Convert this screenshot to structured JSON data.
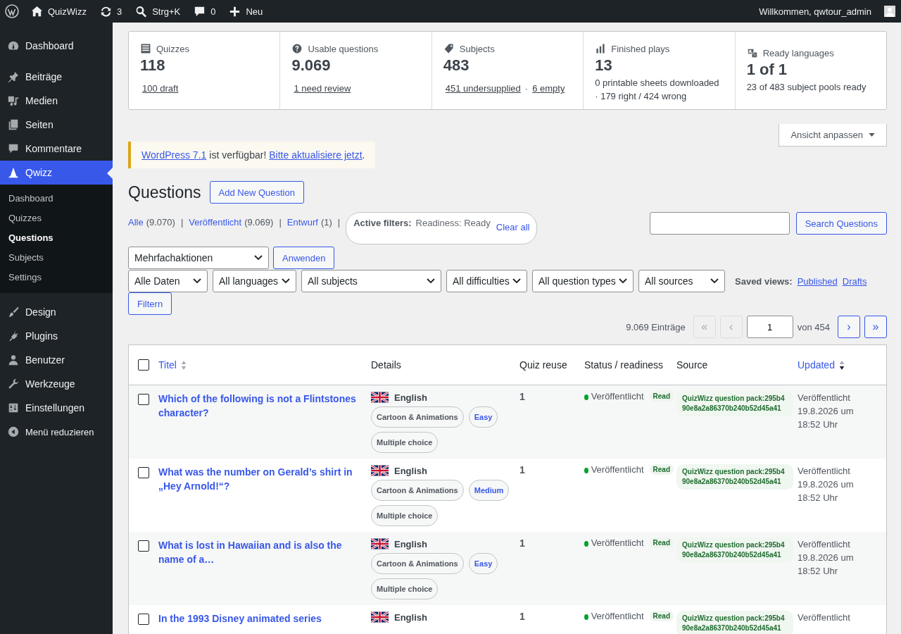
{
  "admin_bar": {
    "items": [
      {
        "label": "QuizWizz"
      },
      {
        "label": "3"
      },
      {
        "label": "Strg+K"
      },
      {
        "label": "0"
      },
      {
        "label": "Neu"
      }
    ],
    "greeting": "Willkommen, qwtour_admin"
  },
  "sidebar": {
    "items": [
      {
        "label": "Dashboard",
        "selected": false
      },
      {
        "label": "Beiträge",
        "selected": false
      },
      {
        "label": "Medien",
        "selected": false
      },
      {
        "label": "Seiten",
        "selected": false
      },
      {
        "label": "Kommentare",
        "selected": false
      },
      {
        "label": "Qwizz",
        "selected": true,
        "children": [
          {
            "label": "Dashboard",
            "selected": false
          },
          {
            "label": "Quizzes",
            "selected": false
          },
          {
            "label": "Questions",
            "selected": true
          },
          {
            "label": "Subjects",
            "selected": false
          },
          {
            "label": "Settings",
            "selected": false
          }
        ]
      },
      {
        "label": "Design",
        "selected": false
      },
      {
        "label": "Plugins",
        "selected": false
      },
      {
        "label": "Benutzer",
        "selected": false
      },
      {
        "label": "Werkzeuge",
        "selected": false
      },
      {
        "label": "Einstellungen",
        "selected": false
      }
    ],
    "collapse": "Menü reduzieren"
  },
  "stats": [
    {
      "label": "Quizzes",
      "value": "118",
      "links": [
        "100 draft"
      ]
    },
    {
      "label": "Usable questions",
      "value": "9.069",
      "links": [
        "1 need review"
      ]
    },
    {
      "label": "Subjects",
      "value": "483",
      "links": [
        "451 undersupplied",
        "6 empty"
      ],
      "separator": "·"
    },
    {
      "label": "Finished plays",
      "value": "13",
      "lines": [
        "0 printable sheets downloaded",
        "· 179 right / 424 wrong"
      ]
    },
    {
      "label": "Ready languages",
      "value": "1 of 1",
      "lines": [
        "23 of 483 subject pools ready"
      ]
    }
  ],
  "screen_options": "Ansicht anpassen",
  "notice": {
    "link": "WordPress 7.1",
    "text": "ist verfügbar!",
    "action": "Bitte aktualisiere jetzt",
    "end": "."
  },
  "heading": "Questions",
  "add_button": "Add New Question",
  "views": {
    "separator": "|",
    "items": [
      {
        "label": "Alle",
        "count": "(9.070)"
      },
      {
        "label": "Veröffentlicht",
        "count": "(9.069)"
      },
      {
        "label": "Entwurf",
        "count": "(1)"
      }
    ]
  },
  "active_filters": {
    "label": "Active filters:",
    "value": "Readiness: Ready",
    "clear": "Clear all"
  },
  "search_button": "Search Questions",
  "bulk": {
    "select": "Mehrfachaktionen",
    "apply": "Anwenden"
  },
  "filters": [
    "Alle Daten",
    "All languages",
    "All subjects",
    "All difficulties",
    "All question types",
    "All sources"
  ],
  "filter_button": "Filtern",
  "saved_views": {
    "label": "Saved views:",
    "links": [
      "Published",
      "Drafts"
    ]
  },
  "pagination": {
    "count": "9.069 Einträge",
    "first": {
      "label": "«",
      "disabled": true
    },
    "prev": {
      "label": "‹",
      "disabled": true
    },
    "page": "1",
    "of": "von 454",
    "next": {
      "label": "›",
      "disabled": false
    },
    "last": {
      "label": "»",
      "disabled": false
    }
  },
  "table": {
    "select_all_checked": false,
    "columns": [
      {
        "label": "Titel",
        "sortable": true,
        "sorted": false
      },
      {
        "label": "Details"
      },
      {
        "label": "Quiz reuse"
      },
      {
        "label": "Status / readiness"
      },
      {
        "label": "Source"
      },
      {
        "label": "Updated",
        "sortable": true,
        "sorted": true
      }
    ],
    "rows": [
      {
        "checked": false,
        "title": "Which of the following is not a Flintstones character?",
        "language": "English",
        "subject": "Cartoon & Animations",
        "difficulty": "Easy",
        "type": "Multiple choice",
        "quiz_reuse": "1",
        "status": "Veröffentlicht",
        "color": "#00a32a",
        "readiness": "Read",
        "source": "QuizWizz question pack:295b490e8a2a86370b240b52d45a41",
        "updated": [
          "Veröffentlicht",
          "19.8.2026 um",
          "18:52 Uhr"
        ]
      },
      {
        "checked": false,
        "title": "What was the number on Gerald’s shirt in „Hey Arnold!“?",
        "language": "English",
        "subject": "Cartoon & Animations",
        "difficulty": "Medium",
        "type": "Multiple choice",
        "quiz_reuse": "1",
        "status": "Veröffentlicht",
        "color": "#00a32a",
        "readiness": "Read",
        "source": "QuizWizz question pack:295b490e8a2a86370b240b52d45a41",
        "updated": [
          "Veröffentlicht",
          "19.8.2026 um",
          "18:52 Uhr"
        ]
      },
      {
        "checked": false,
        "title": "What is lost in Hawaiian and is also the name of a…",
        "language": "English",
        "subject": "Cartoon & Animations",
        "difficulty": "Easy",
        "type": "Multiple choice",
        "quiz_reuse": "1",
        "status": "Veröffentlicht",
        "color": "#00a32a",
        "readiness": "Read",
        "source": "QuizWizz question pack:295b490e8a2a86370b240b52d45a41",
        "updated": [
          "Veröffentlicht",
          "19.8.2026 um",
          "18:52 Uhr"
        ]
      },
      {
        "checked": false,
        "title": "In the 1993 Disney animated series",
        "language": "English",
        "quiz_reuse": "1",
        "status": "Veröffentlicht",
        "color": "#00a32a",
        "readiness": "Read",
        "source": "QuizWizz question pack:295b490e8a2a86370b240b52d45a41",
        "updated": [
          "Veröffentlicht"
        ]
      }
    ]
  }
}
